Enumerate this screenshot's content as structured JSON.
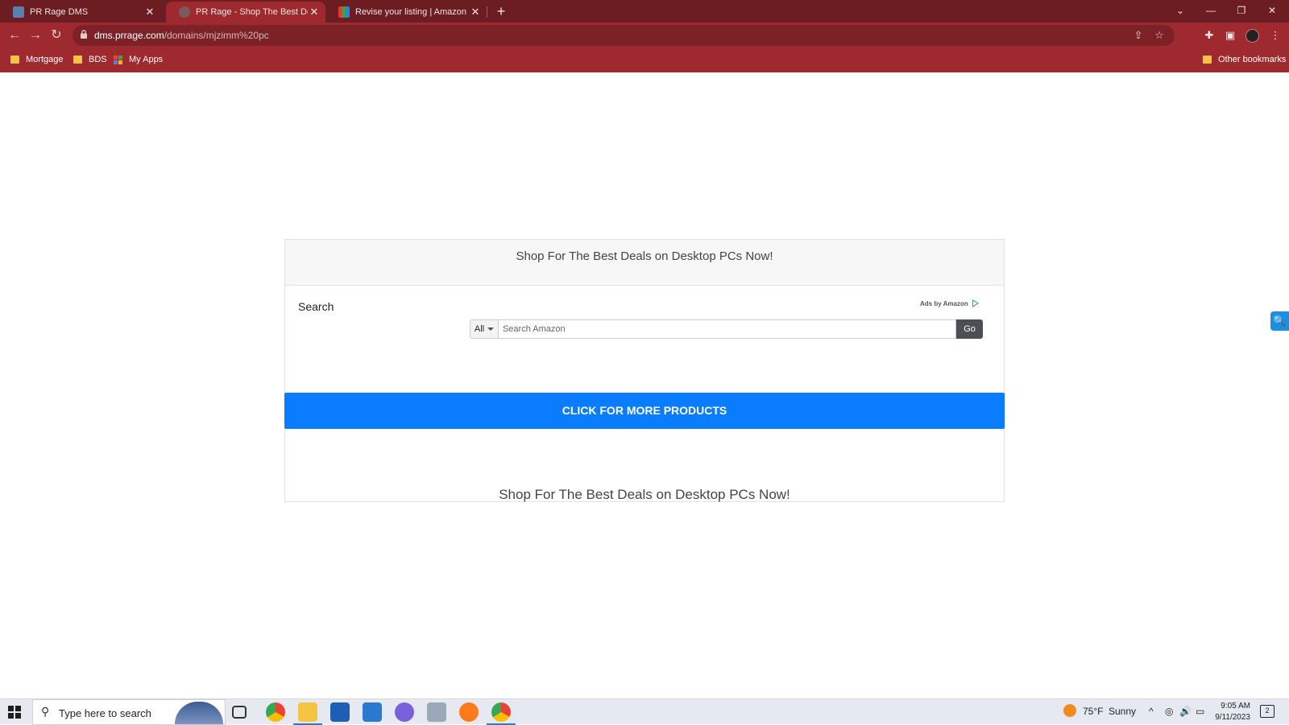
{
  "browser": {
    "tabs": [
      {
        "title": "PR Rage DMS",
        "active": false
      },
      {
        "title": "PR Rage - Shop The Best Deskto",
        "active": true
      },
      {
        "title": "Revise your listing | Amazon Eco",
        "active": false
      }
    ],
    "new_tab_icon": "plus-icon",
    "url_host": "dms.prrage.com",
    "url_path": "/domains/mjzimm%20pc",
    "bookmarks": [
      "Mortgage",
      "BDS",
      "My Apps"
    ],
    "other_bookmarks": "Other bookmarks"
  },
  "page": {
    "card_heading": "Shop For The Best Deals on Desktop PCs Now!",
    "search_label": "Search",
    "ads_by": "Ads by Amazon",
    "category_select": "All",
    "search_placeholder": "Search Amazon",
    "go_button": "Go",
    "cta_button": "CLICK FOR MORE PRODUCTS",
    "bottom_heading": "Shop For The Best Deals on Desktop PCs Now!",
    "accent_color": "#0a7cff"
  },
  "taskbar": {
    "search_placeholder": "Type here to search",
    "weather_temp": "75°F",
    "weather_text": "Sunny",
    "time": "9:05 AM",
    "date": "9/11/2023",
    "notifications_count": "2"
  }
}
